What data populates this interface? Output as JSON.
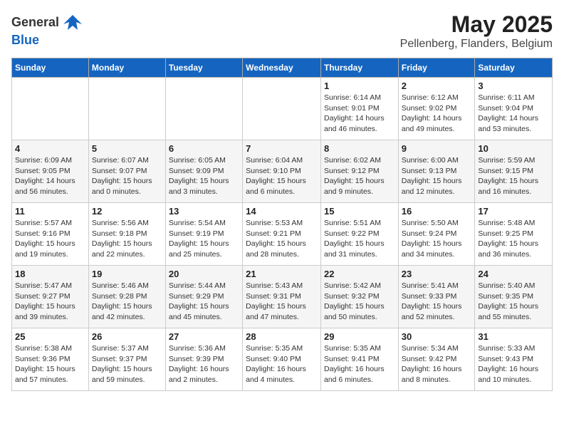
{
  "header": {
    "logo_general": "General",
    "logo_blue": "Blue",
    "month": "May 2025",
    "location": "Pellenberg, Flanders, Belgium"
  },
  "days_of_week": [
    "Sunday",
    "Monday",
    "Tuesday",
    "Wednesday",
    "Thursday",
    "Friday",
    "Saturday"
  ],
  "weeks": [
    [
      {
        "day": "",
        "info": ""
      },
      {
        "day": "",
        "info": ""
      },
      {
        "day": "",
        "info": ""
      },
      {
        "day": "",
        "info": ""
      },
      {
        "day": "1",
        "info": "Sunrise: 6:14 AM\nSunset: 9:01 PM\nDaylight: 14 hours\nand 46 minutes."
      },
      {
        "day": "2",
        "info": "Sunrise: 6:12 AM\nSunset: 9:02 PM\nDaylight: 14 hours\nand 49 minutes."
      },
      {
        "day": "3",
        "info": "Sunrise: 6:11 AM\nSunset: 9:04 PM\nDaylight: 14 hours\nand 53 minutes."
      }
    ],
    [
      {
        "day": "4",
        "info": "Sunrise: 6:09 AM\nSunset: 9:05 PM\nDaylight: 14 hours\nand 56 minutes."
      },
      {
        "day": "5",
        "info": "Sunrise: 6:07 AM\nSunset: 9:07 PM\nDaylight: 15 hours\nand 0 minutes."
      },
      {
        "day": "6",
        "info": "Sunrise: 6:05 AM\nSunset: 9:09 PM\nDaylight: 15 hours\nand 3 minutes."
      },
      {
        "day": "7",
        "info": "Sunrise: 6:04 AM\nSunset: 9:10 PM\nDaylight: 15 hours\nand 6 minutes."
      },
      {
        "day": "8",
        "info": "Sunrise: 6:02 AM\nSunset: 9:12 PM\nDaylight: 15 hours\nand 9 minutes."
      },
      {
        "day": "9",
        "info": "Sunrise: 6:00 AM\nSunset: 9:13 PM\nDaylight: 15 hours\nand 12 minutes."
      },
      {
        "day": "10",
        "info": "Sunrise: 5:59 AM\nSunset: 9:15 PM\nDaylight: 15 hours\nand 16 minutes."
      }
    ],
    [
      {
        "day": "11",
        "info": "Sunrise: 5:57 AM\nSunset: 9:16 PM\nDaylight: 15 hours\nand 19 minutes."
      },
      {
        "day": "12",
        "info": "Sunrise: 5:56 AM\nSunset: 9:18 PM\nDaylight: 15 hours\nand 22 minutes."
      },
      {
        "day": "13",
        "info": "Sunrise: 5:54 AM\nSunset: 9:19 PM\nDaylight: 15 hours\nand 25 minutes."
      },
      {
        "day": "14",
        "info": "Sunrise: 5:53 AM\nSunset: 9:21 PM\nDaylight: 15 hours\nand 28 minutes."
      },
      {
        "day": "15",
        "info": "Sunrise: 5:51 AM\nSunset: 9:22 PM\nDaylight: 15 hours\nand 31 minutes."
      },
      {
        "day": "16",
        "info": "Sunrise: 5:50 AM\nSunset: 9:24 PM\nDaylight: 15 hours\nand 34 minutes."
      },
      {
        "day": "17",
        "info": "Sunrise: 5:48 AM\nSunset: 9:25 PM\nDaylight: 15 hours\nand 36 minutes."
      }
    ],
    [
      {
        "day": "18",
        "info": "Sunrise: 5:47 AM\nSunset: 9:27 PM\nDaylight: 15 hours\nand 39 minutes."
      },
      {
        "day": "19",
        "info": "Sunrise: 5:46 AM\nSunset: 9:28 PM\nDaylight: 15 hours\nand 42 minutes."
      },
      {
        "day": "20",
        "info": "Sunrise: 5:44 AM\nSunset: 9:29 PM\nDaylight: 15 hours\nand 45 minutes."
      },
      {
        "day": "21",
        "info": "Sunrise: 5:43 AM\nSunset: 9:31 PM\nDaylight: 15 hours\nand 47 minutes."
      },
      {
        "day": "22",
        "info": "Sunrise: 5:42 AM\nSunset: 9:32 PM\nDaylight: 15 hours\nand 50 minutes."
      },
      {
        "day": "23",
        "info": "Sunrise: 5:41 AM\nSunset: 9:33 PM\nDaylight: 15 hours\nand 52 minutes."
      },
      {
        "day": "24",
        "info": "Sunrise: 5:40 AM\nSunset: 9:35 PM\nDaylight: 15 hours\nand 55 minutes."
      }
    ],
    [
      {
        "day": "25",
        "info": "Sunrise: 5:38 AM\nSunset: 9:36 PM\nDaylight: 15 hours\nand 57 minutes."
      },
      {
        "day": "26",
        "info": "Sunrise: 5:37 AM\nSunset: 9:37 PM\nDaylight: 15 hours\nand 59 minutes."
      },
      {
        "day": "27",
        "info": "Sunrise: 5:36 AM\nSunset: 9:39 PM\nDaylight: 16 hours\nand 2 minutes."
      },
      {
        "day": "28",
        "info": "Sunrise: 5:35 AM\nSunset: 9:40 PM\nDaylight: 16 hours\nand 4 minutes."
      },
      {
        "day": "29",
        "info": "Sunrise: 5:35 AM\nSunset: 9:41 PM\nDaylight: 16 hours\nand 6 minutes."
      },
      {
        "day": "30",
        "info": "Sunrise: 5:34 AM\nSunset: 9:42 PM\nDaylight: 16 hours\nand 8 minutes."
      },
      {
        "day": "31",
        "info": "Sunrise: 5:33 AM\nSunset: 9:43 PM\nDaylight: 16 hours\nand 10 minutes."
      }
    ]
  ]
}
